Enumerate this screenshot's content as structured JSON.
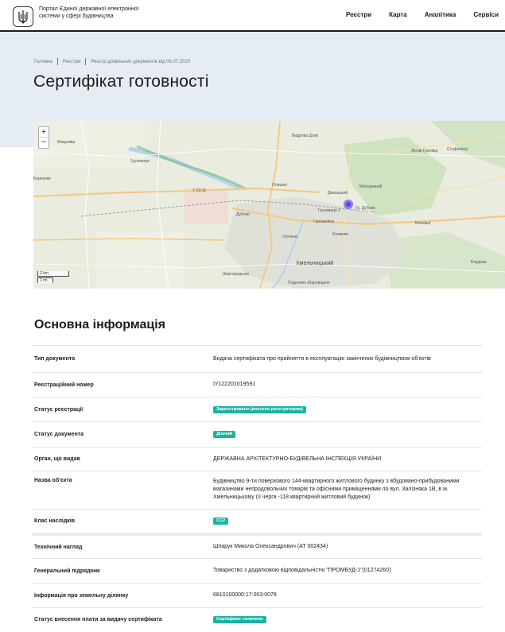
{
  "header": {
    "portal_name": "Портал Єдиної державної електронної системи у сфері будівництва",
    "nav": [
      "Реєстри",
      "Карта",
      "Аналітика",
      "Сервіси"
    ]
  },
  "breadcrumb": [
    "Головна",
    "Реєстри",
    "Реєстр дозвільних документів від 06.07.2020"
  ],
  "page_title": "Сертифікат готовності",
  "map": {
    "zoom_in": "+",
    "zoom_out": "−",
    "scale_km": "2 km",
    "scale_mi": "1 mi",
    "labels": [
      "Мацьківці",
      "Березове",
      "Грузевиця",
      "Видрова Доли",
      "Лісові Гринівці",
      "Стуфанівці",
      "Олешин",
      "Дивоцький",
      "Гарнишівка",
      "Т-23-11",
      "Дубово",
      "Гречани",
      "Климове",
      "Масківці",
      "Хмельницький",
      "Шаргородське",
      "Подинино-Шаровщине",
      "Блудова",
      "Молодіжний",
      "Грузевиця 2",
      "Гр. Дубово"
    ]
  },
  "section_title": "Основна інформація",
  "rows": [
    {
      "label": "Тип документа",
      "value": "Видача сертифіката про прийняття в експлуатацію закінчених будівництвом об'єктів",
      "badge": false
    },
    {
      "label": "Реєстраційний номер",
      "value": "ІУ122201019591",
      "badge": false
    },
    {
      "label": "Статус реєстрації",
      "value": "Зареєстровано (внесено реєстратором)",
      "badge": true
    },
    {
      "label": "Статус документа",
      "value": "Діючий",
      "badge": true
    },
    {
      "label": "Орган, що видав",
      "value": "ДЕРЖАВНА АРХІТЕКТУРНО-БУДІВЕЛЬНА ІНСПЕКЦІЯ УКРАЇНИ",
      "badge": false
    },
    {
      "label": "Назва об'єкта",
      "value": "Будівництво 9-ти поверхового 144-квартирного житлового будинку з вбудовано-прибудованими магазинами непродовольчих товарів та офісними приміщеннями по вул. Залізняка 1В, в м. Хмельницькому (ІІ черга -118 квартирний житловий будинок)",
      "badge": false
    },
    {
      "label": "Клас наслідків",
      "value": "СС2",
      "badge": true
    },
    {
      "label": "Технічний нагляд",
      "value": "Шпарук Микола Олександрович (АТ 002434)",
      "badge": false
    },
    {
      "label": "Генеральний підрядник",
      "value": "Товариство з додатковою відповідальністю \"ПРОМБУД-1\"(01274260)",
      "badge": false
    },
    {
      "label": "Інформація про земельну ділянку",
      "value": "6810100000:17:003:0078",
      "badge": false
    },
    {
      "label": "Статус внесення плати за видачу сертифіката",
      "value": "Сертифікат сплачено",
      "badge": true
    }
  ],
  "colors": {
    "badge": "#19b3a1",
    "hero_bg": "#e5ecf3",
    "marker": "#7b6cf0"
  }
}
